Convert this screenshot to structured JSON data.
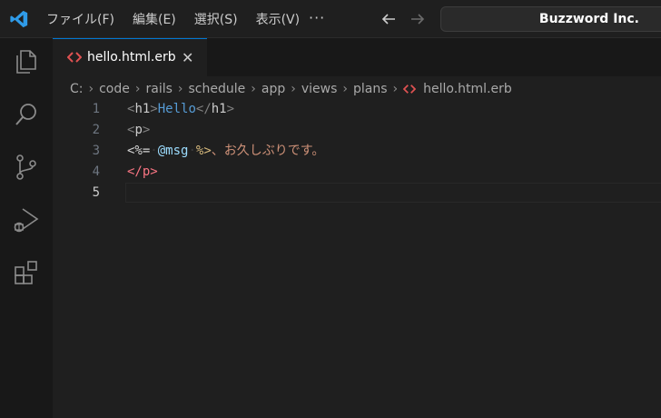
{
  "menu": [
    "ファイル(F)",
    "編集(E)",
    "選択(S)",
    "表示(V)"
  ],
  "more_label": "···",
  "search": {
    "value": "Buzzword Inc."
  },
  "activity": [
    "explorer-icon",
    "search-icon",
    "source-control-icon",
    "run-debug-icon",
    "extensions-icon"
  ],
  "tab": {
    "label": "hello.html.erb",
    "close": "✕"
  },
  "breadcrumb": [
    "C:",
    "code",
    "rails",
    "schedule",
    "app",
    "views",
    "plans",
    "hello.html.erb"
  ],
  "editor": {
    "line_numbers": [
      "1",
      "2",
      "3",
      "4",
      "5"
    ],
    "line1": {
      "open": "<",
      "name": "h1",
      "close": ">",
      "text": "Hello",
      "end_open": "</",
      "end_name": "h1",
      "end_close": ">"
    },
    "line2": {
      "open": "<",
      "name": "p",
      "close": ">"
    },
    "line3": {
      "erb_open": "<%=",
      "dot1": "·",
      "ivar": "@msg",
      "dot2": "·",
      "erb_close": "%>",
      "text": "、お久しぶりです。"
    },
    "line4": {
      "end": "</p>"
    }
  },
  "colors": {
    "accent": "#0078d4",
    "erb_icon": "#e05252"
  }
}
